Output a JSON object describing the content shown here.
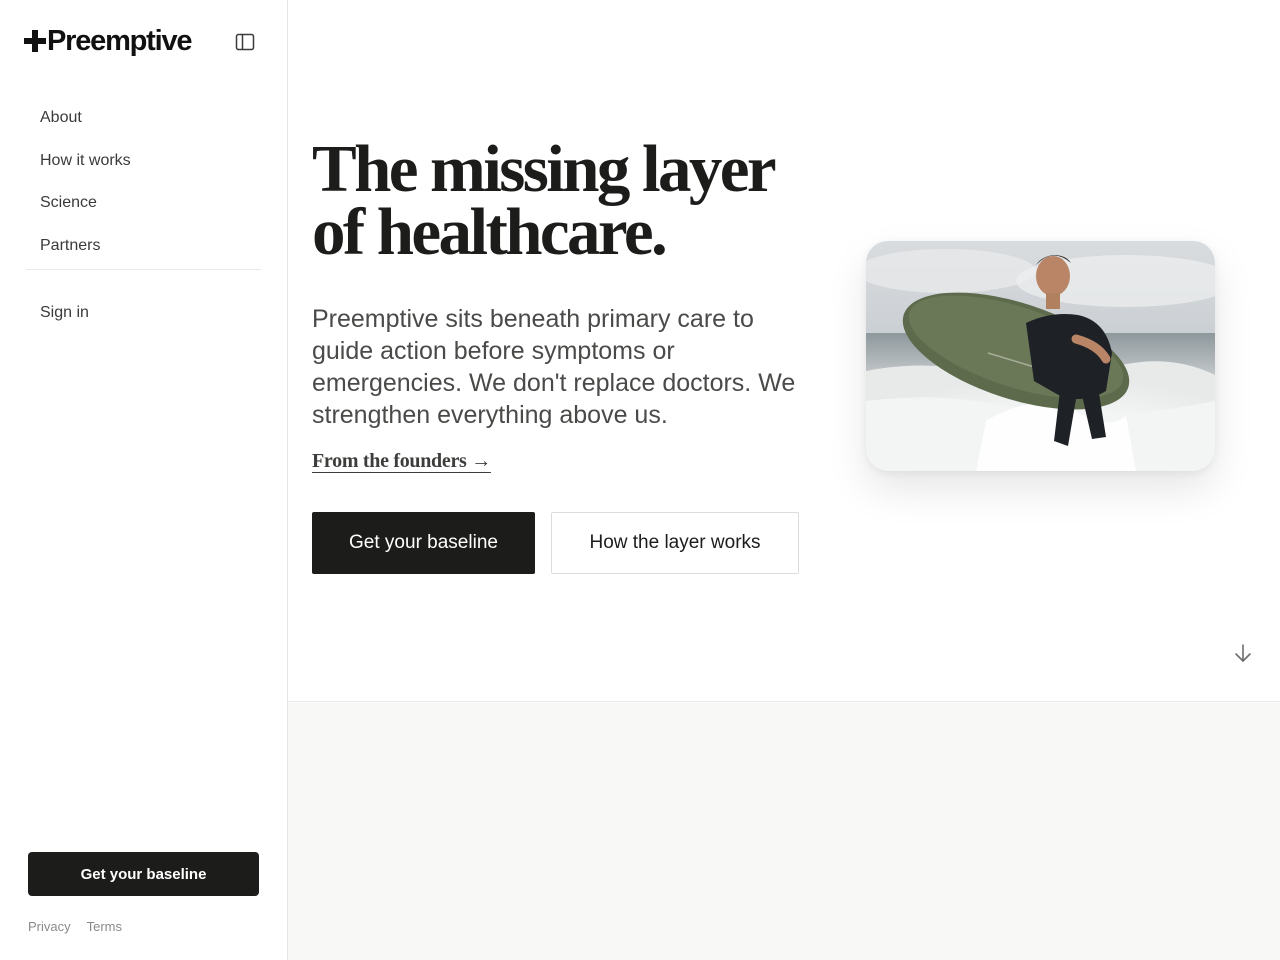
{
  "brand": {
    "name": "Preemptive"
  },
  "sidebar": {
    "collapse_icon": "sidebar-panel-icon",
    "items": [
      {
        "label": "About"
      },
      {
        "label": "How it works"
      },
      {
        "label": "Science"
      },
      {
        "label": "Partners"
      }
    ],
    "signin_label": "Sign in",
    "cta_label": "Get your baseline",
    "footer": {
      "privacy": "Privacy",
      "terms": "Terms"
    }
  },
  "hero": {
    "headline_line1": "The missing layer",
    "headline_line2": "of healthcare.",
    "subtext": "Preemptive sits beneath primary care to guide action before symptoms or emergencies. We don't replace doctors. We strengthen everything above us.",
    "founders_link": "From the founders →",
    "primary_cta": "Get your baseline",
    "secondary_cta": "How the layer works",
    "image_subject": "man-carrying-surfboard-in-surf",
    "scroll_icon": "arrow-down-icon"
  },
  "colors": {
    "primary": "#1c1d1b",
    "text_muted": "#4a4b48",
    "border": "#e6e6e4",
    "section_bg": "#f8f8f7"
  }
}
